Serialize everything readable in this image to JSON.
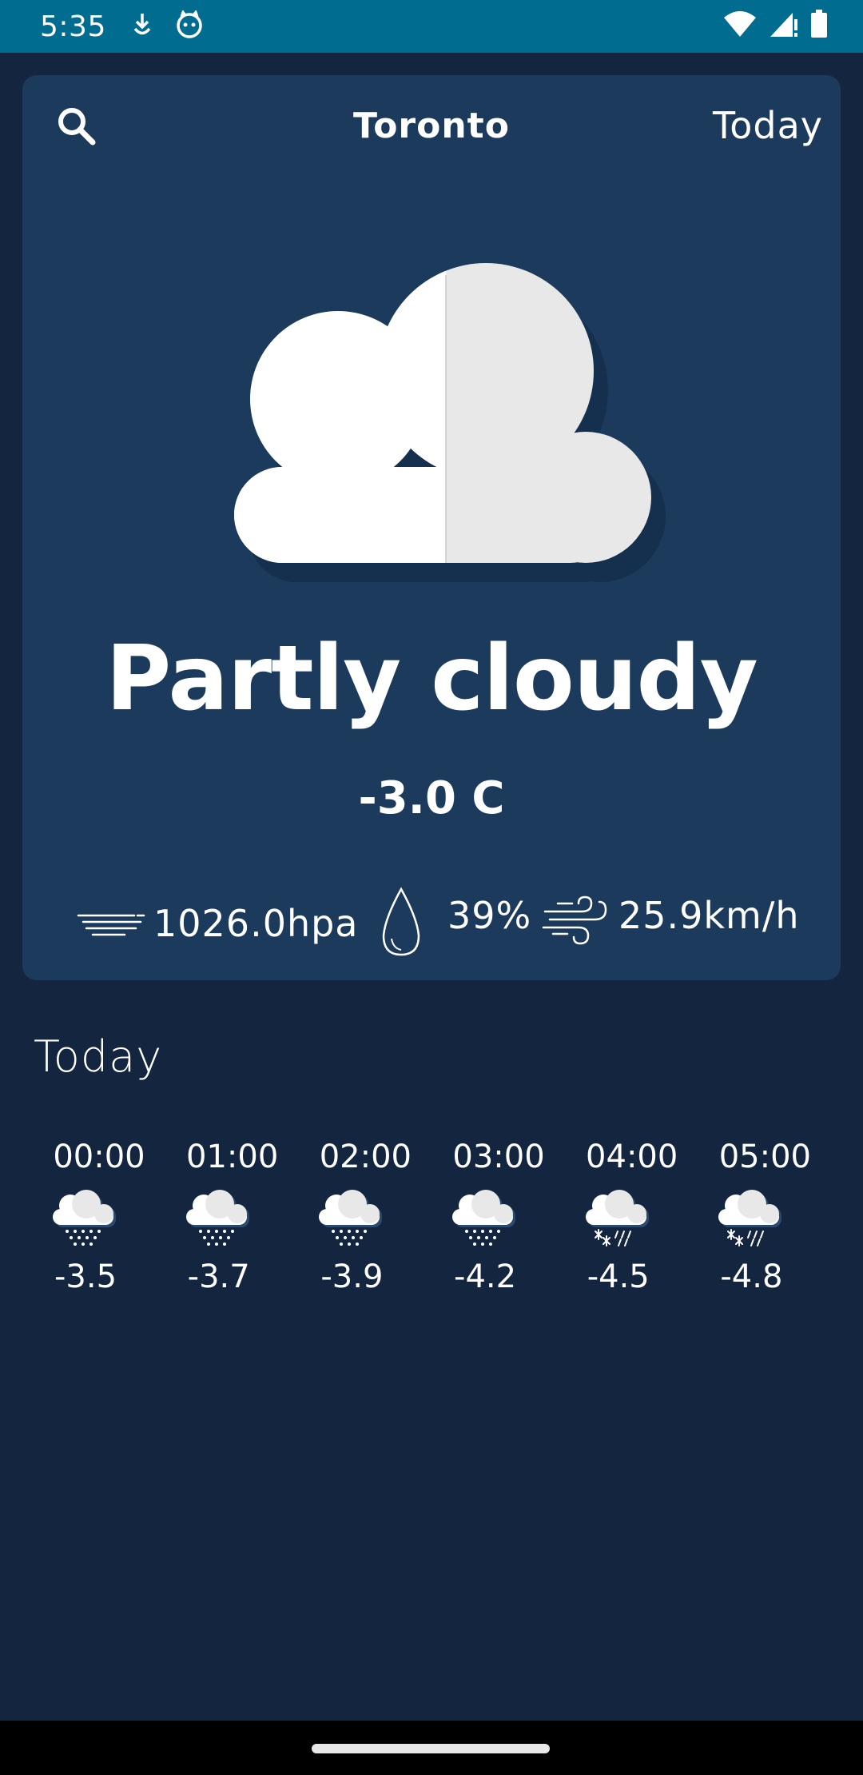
{
  "status_bar": {
    "time": "5:35",
    "icons": [
      "download-icon",
      "cat-face-icon",
      "wifi-icon",
      "signal-icon",
      "battery-icon"
    ]
  },
  "header": {
    "city": "Toronto",
    "today_label": "Today",
    "search_icon": "search-icon"
  },
  "current": {
    "condition": "Partly cloudy",
    "temperature": "-3.0 C",
    "icon": "partly-cloudy-icon",
    "pressure": "1026.0hpa",
    "humidity": "39%",
    "wind": "25.9km/h"
  },
  "hourly_section": {
    "title": "Today"
  },
  "hourly": [
    {
      "time": "00:00",
      "temp": "-3.5",
      "icon": "snow-cloud-icon"
    },
    {
      "time": "01:00",
      "temp": "-3.7",
      "icon": "snow-cloud-icon"
    },
    {
      "time": "02:00",
      "temp": "-3.9",
      "icon": "snow-cloud-icon"
    },
    {
      "time": "03:00",
      "temp": "-4.2",
      "icon": "snow-cloud-icon"
    },
    {
      "time": "04:00",
      "temp": "-4.5",
      "icon": "sleet-cloud-icon"
    },
    {
      "time": "05:00",
      "temp": "-4.8",
      "icon": "sleet-cloud-icon"
    }
  ],
  "colors": {
    "background": "#13253f",
    "card": "#1c3a5c",
    "status_bar": "#006c8f"
  }
}
